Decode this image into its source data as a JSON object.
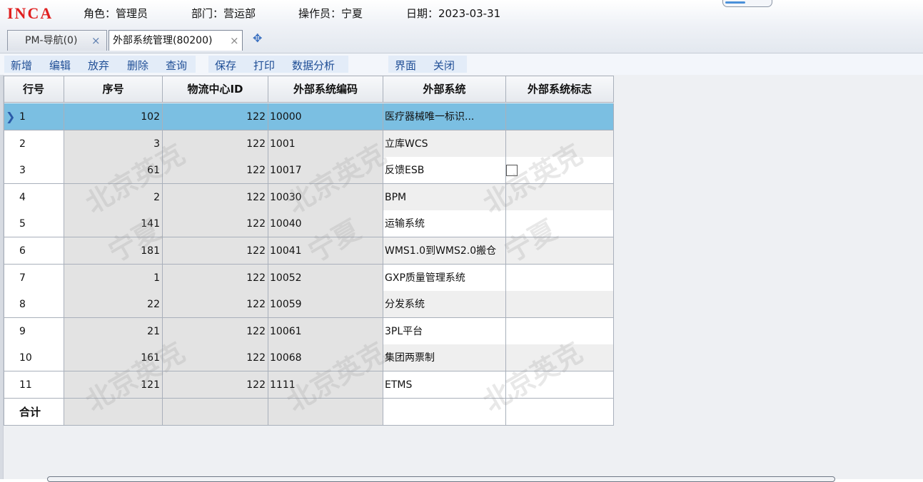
{
  "header": {
    "logo": "INCA",
    "role": "角色：管理员",
    "dept": "部门：营运部",
    "operator": "操作员：宁夏",
    "date": "日期：2023-03-31"
  },
  "tabs": [
    {
      "label": "PM-导航(0)",
      "close": "×"
    },
    {
      "label": "外部系统管理(80200)",
      "close": "×"
    }
  ],
  "add_tab_icon": "✥",
  "toolbar": {
    "new": "新增",
    "edit": "编辑",
    "discard": "放弃",
    "delete": "删除",
    "query": "查询",
    "save": "保存",
    "print": "打印",
    "analysis": "数据分析",
    "ui": "界面",
    "close": "关闭"
  },
  "table": {
    "columns": [
      "行号",
      "序号",
      "物流中心ID",
      "外部系统编码",
      "外部系统",
      "外部系统标志"
    ],
    "rows": [
      {
        "row": "1",
        "seq": "102",
        "center": "122",
        "code": "10000",
        "name": "医疗器械唯一标识..."
      },
      {
        "row": "2",
        "seq": "3",
        "center": "122",
        "code": "1001",
        "name": "立库WCS"
      },
      {
        "row": "3",
        "seq": "61",
        "center": "122",
        "code": "10017",
        "name": "反馈ESB"
      },
      {
        "row": "4",
        "seq": "2",
        "center": "122",
        "code": "10030",
        "name": "BPM"
      },
      {
        "row": "5",
        "seq": "141",
        "center": "122",
        "code": "10040",
        "name": "运输系统"
      },
      {
        "row": "6",
        "seq": "181",
        "center": "122",
        "code": "10041",
        "name": "WMS1.0到WMS2.0搬仓"
      },
      {
        "row": "7",
        "seq": "1",
        "center": "122",
        "code": "10052",
        "name": "GXP质量管理系统"
      },
      {
        "row": "8",
        "seq": "22",
        "center": "122",
        "code": "10059",
        "name": "分发系统"
      },
      {
        "row": "9",
        "seq": "21",
        "center": "122",
        "code": "10061",
        "name": "3PL平台"
      },
      {
        "row": "10",
        "seq": "161",
        "center": "122",
        "code": "10068",
        "name": "集团两票制"
      },
      {
        "row": "11",
        "seq": "121",
        "center": "122",
        "code": "1111",
        "name": "ETMS"
      }
    ],
    "total_label": "合计"
  },
  "watermark": {
    "company": "北京英克",
    "user": "宁夏"
  },
  "colors": {
    "selected_row": "#7bbfe2",
    "logo": "#e02020",
    "toolbar_text": "#1f4e96"
  }
}
